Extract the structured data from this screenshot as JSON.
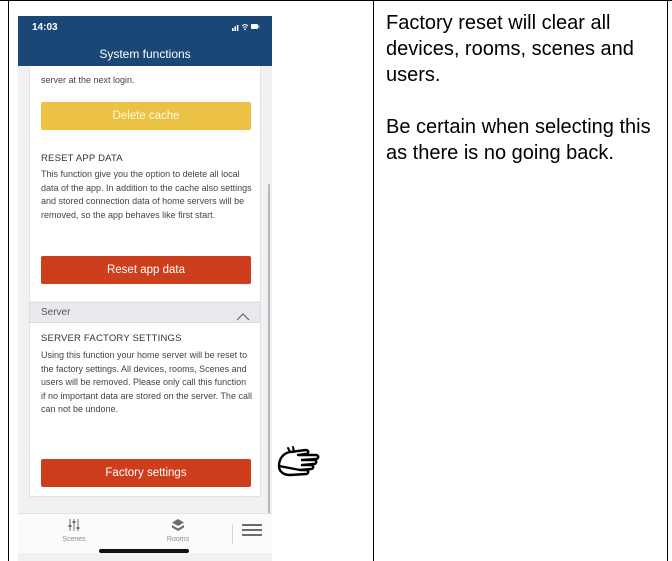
{
  "status_bar": {
    "time": "14:03",
    "signal_icons": "signal-wifi-battery-icons"
  },
  "nav": {
    "title": "System functions"
  },
  "cache_card": {
    "text_tail": "server at the next login.",
    "button": "Delete cache"
  },
  "reset_app": {
    "heading": "RESET APP DATA",
    "description": "This function give you the option to delete all local data of the app. In addition to the cache also settings and stored connection data of home servers will be removed, so the app behaves like first start.",
    "button": "Reset app data"
  },
  "server": {
    "section_label": "Server",
    "heading": "SERVER FACTORY SETTINGS",
    "description": "Using this function your home server will be reset to the factory settings. All devices, rooms, Scenes and users will be removed. Please only call this function if no important data are stored on the server. The call can not be undone.",
    "button": "Factory settings"
  },
  "tabbar": {
    "tabs": [
      {
        "label": "Scenes",
        "icon": "sliders-icon"
      },
      {
        "label": "Rooms",
        "icon": "rooms-icon"
      }
    ],
    "menu_icon": "hamburger-icon"
  },
  "annotation": {
    "paragraph1": "Factory reset will clear all devices, rooms, scenes and users.",
    "paragraph2": "Be certain when selecting this as there is no going back."
  },
  "colors": {
    "nav_blue": "#1b4776",
    "yellow_button": "#ecc245",
    "red_button": "#cc3e1c"
  }
}
